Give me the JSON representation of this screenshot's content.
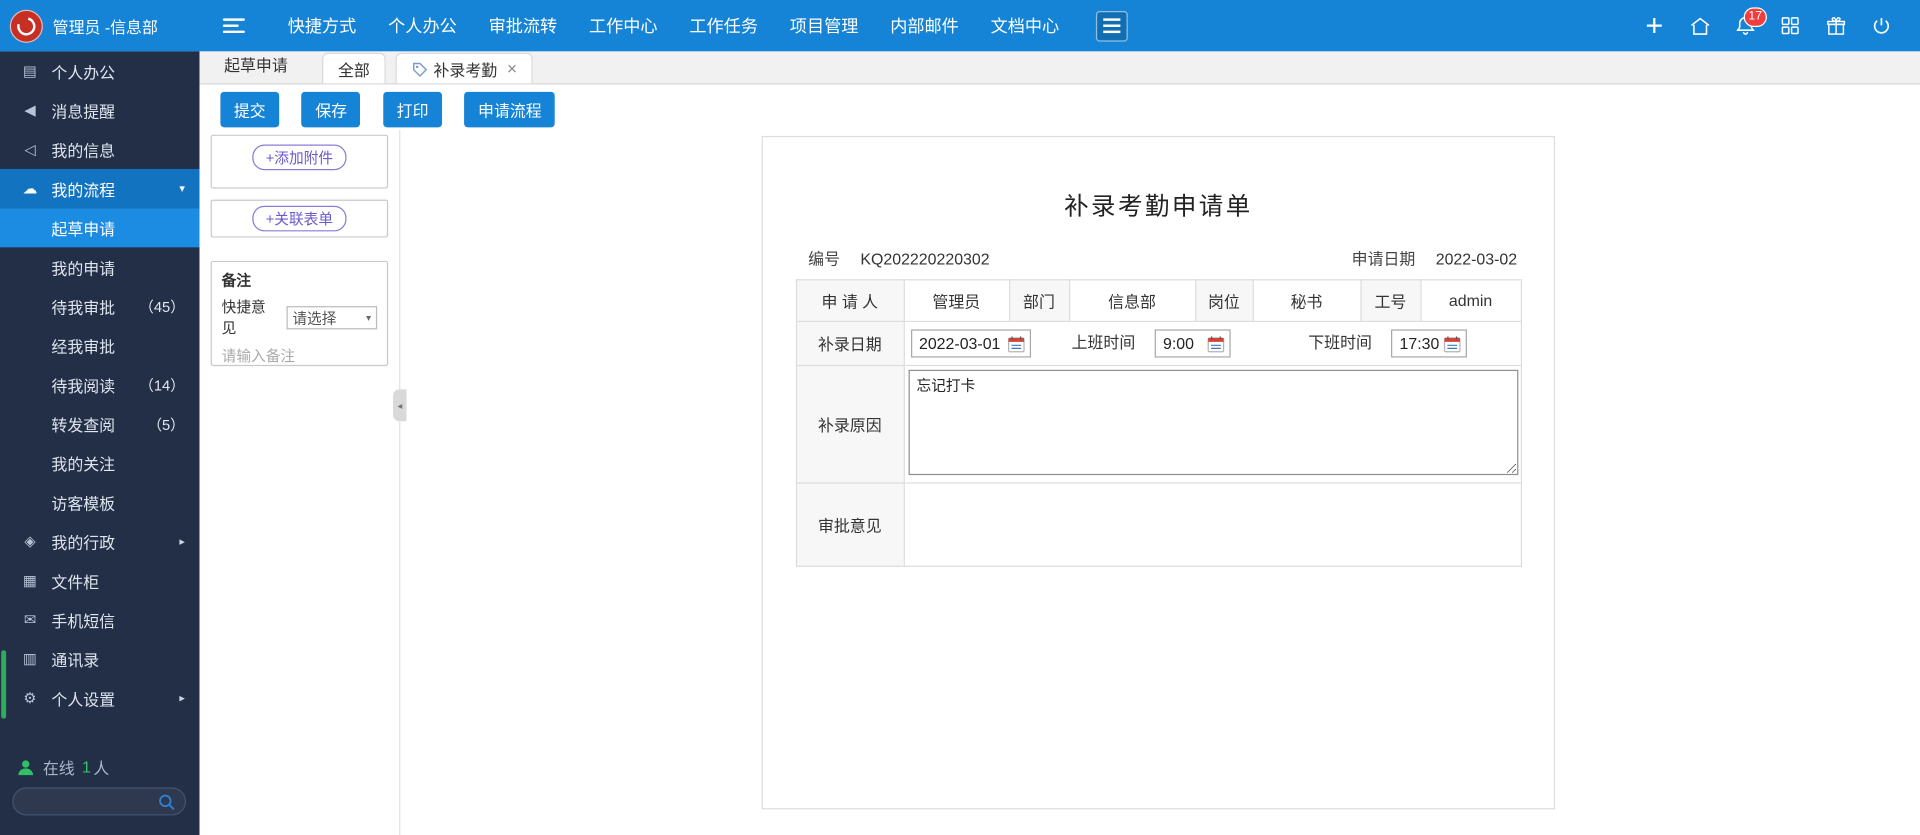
{
  "colors": {
    "accent": "#1584d6",
    "sidebar_bg": "#232f47",
    "badge_red": "#f03e3e",
    "online_green": "#35c06a",
    "pill_purple": "#6a5acd"
  },
  "icons": {
    "plus": "+",
    "chevron_down": "▾",
    "chevron_right": "▸",
    "chevron_left": "◂"
  },
  "topbar": {
    "user": "管理员 -信息部",
    "nav": [
      "快捷方式",
      "个人办公",
      "审批流转",
      "工作中心",
      "工作任务",
      "项目管理",
      "内部邮件",
      "文档中心"
    ],
    "badge_count": "17"
  },
  "sidebar": {
    "top": [
      {
        "label": "个人办公",
        "icon": "▤"
      },
      {
        "label": "消息提醒",
        "icon": "◀"
      },
      {
        "label": "我的信息",
        "icon": "◁"
      }
    ],
    "flow": {
      "label": "我的流程",
      "icon": "☁"
    },
    "flow_children": [
      {
        "label": "起草申请"
      },
      {
        "label": "我的申请"
      },
      {
        "label": "待我审批",
        "count": "（45）"
      },
      {
        "label": "经我审批"
      },
      {
        "label": "待我阅读",
        "count": "（14）"
      },
      {
        "label": "转发查阅",
        "count": "（5）"
      },
      {
        "label": "我的关注"
      },
      {
        "label": "访客模板"
      }
    ],
    "bottom": [
      {
        "label": "我的行政",
        "icon": "◈"
      },
      {
        "label": "文件柜",
        "icon": "▦"
      },
      {
        "label": "手机短信",
        "icon": "✉"
      },
      {
        "label": "通讯录",
        "icon": "▥"
      },
      {
        "label": "个人设置",
        "icon": "⚙"
      }
    ],
    "online_prefix": "在线",
    "online_count": "1",
    "online_suffix": "人"
  },
  "tabs": {
    "source": "起草申请",
    "all": "全部",
    "current": "补录考勤",
    "close": "×"
  },
  "actions": {
    "submit": "提交",
    "save": "保存",
    "print": "打印",
    "flow": "申请流程"
  },
  "panel": {
    "add_attachment": "+添加附件",
    "link_form": "+关联表单",
    "note_title": "备注",
    "quick_opinion_label": "快捷意见",
    "quick_opinion_value": "请选择",
    "note_placeholder": "请输入备注"
  },
  "form": {
    "title": "补录考勤申请单",
    "number_label": "编号",
    "number_value": "KQ202220220302",
    "apply_date_label": "申请日期",
    "apply_date_value": "2022-03-02",
    "applicant_label": "申 请 人",
    "applicant_value": "管理员",
    "dept_label": "部门",
    "dept_value": "信息部",
    "post_label": "岗位",
    "post_value": "秘书",
    "jobno_label": "工号",
    "jobno_value": "admin",
    "date_label": "补录日期",
    "date_value": "2022-03-01",
    "start_label": "上班时间",
    "start_value": "9:00",
    "end_label": "下班时间",
    "end_value": "17:30",
    "reason_label": "补录原因",
    "reason_value": "忘记打卡",
    "approval_label": "审批意见"
  }
}
